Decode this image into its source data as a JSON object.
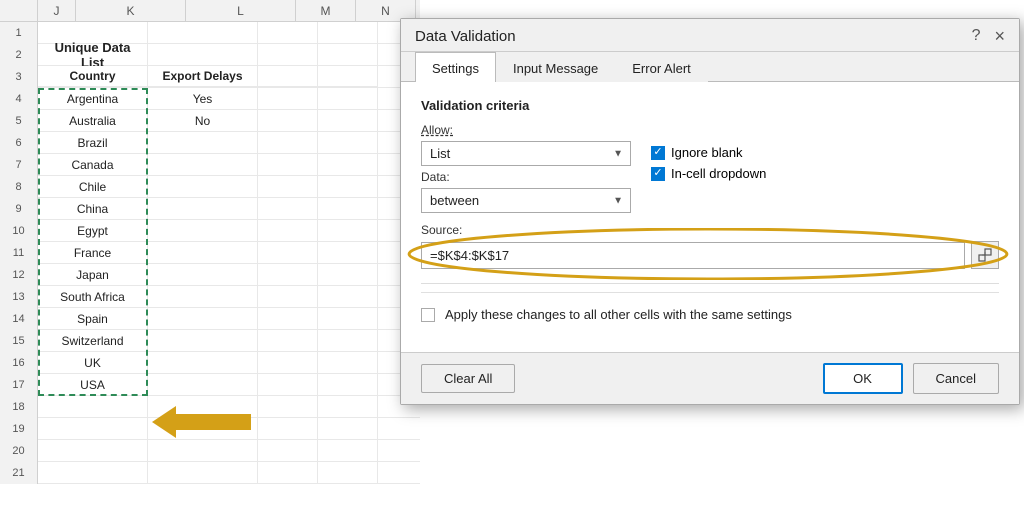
{
  "spreadsheet": {
    "col_headers": [
      "J",
      "K",
      "L",
      "M",
      "N"
    ],
    "title": "Unique Data List",
    "headers": {
      "country": "Country",
      "export_delays": "Export Delays"
    },
    "rows": [
      {
        "row": 4,
        "country": "Argentina",
        "export": "Yes"
      },
      {
        "row": 5,
        "country": "Australia",
        "export": "No"
      },
      {
        "row": 6,
        "country": "Brazil",
        "export": ""
      },
      {
        "row": 7,
        "country": "Canada",
        "export": ""
      },
      {
        "row": 8,
        "country": "Chile",
        "export": ""
      },
      {
        "row": 9,
        "country": "China",
        "export": ""
      },
      {
        "row": 10,
        "country": "Egypt",
        "export": ""
      },
      {
        "row": 11,
        "country": "France",
        "export": ""
      },
      {
        "row": 12,
        "country": "Japan",
        "export": ""
      },
      {
        "row": 13,
        "country": "South Africa",
        "export": ""
      },
      {
        "row": 14,
        "country": "Spain",
        "export": ""
      },
      {
        "row": 15,
        "country": "Switzerland",
        "export": ""
      },
      {
        "row": 16,
        "country": "UK",
        "export": ""
      },
      {
        "row": 17,
        "country": "USA",
        "export": ""
      }
    ],
    "row_numbers": [
      1,
      2,
      3,
      4,
      5,
      6,
      7,
      8,
      9,
      10,
      11,
      12,
      13,
      14,
      15,
      16,
      17,
      18,
      19,
      20,
      21
    ]
  },
  "dialog": {
    "title": "Data Validation",
    "tabs": [
      "Settings",
      "Input Message",
      "Error Alert"
    ],
    "active_tab": "Settings",
    "help_label": "?",
    "close_label": "×",
    "validation_criteria_label": "Validation criteria",
    "allow_label": "Allow:",
    "allow_value": "List",
    "data_label": "Data:",
    "data_value": "between",
    "ignore_blank_label": "Ignore blank",
    "in_cell_dropdown_label": "In-cell dropdown",
    "source_label": "Source:",
    "source_value": "=$K$4:$K$17",
    "apply_label": "Apply these changes to all other cells with the same settings",
    "clear_all_label": "Clear All",
    "ok_label": "OK",
    "cancel_label": "Cancel"
  }
}
